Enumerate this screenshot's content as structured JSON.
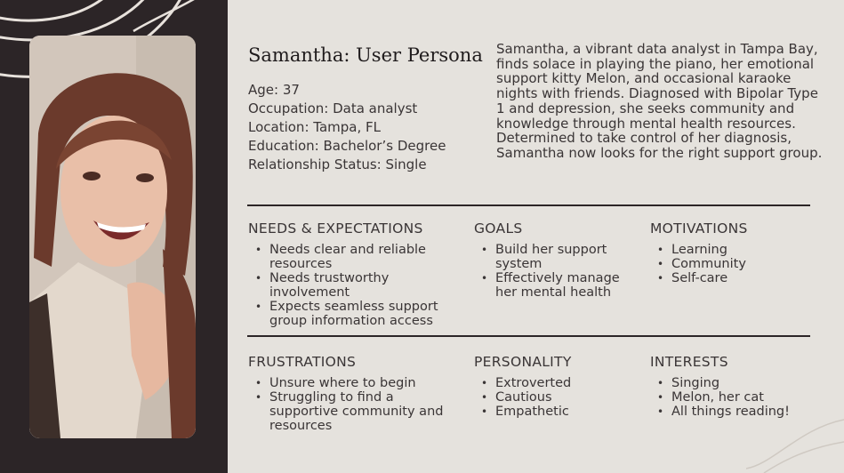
{
  "persona": {
    "title": "Samantha: User Persona",
    "facts": {
      "age": "Age: 37",
      "occupation": "Occupation: Data analyst",
      "location": "Location: Tampa, FL",
      "education": "Education: Bachelor’s Degree",
      "relationship": "Relationship Status: Single"
    },
    "bio": "Samantha, a vibrant data analyst in Tampa Bay, finds solace in playing the piano, her emotional support kitty Melon, and occasional karaoke nights with friends. Diagnosed with Bipolar Type 1 and depression, she seeks community and knowledge through mental health resources. Determined to take control of her diagnosis, Samantha now looks for the right support group."
  },
  "sections": {
    "needs": {
      "heading": "NEEDS & EXPECTATIONS",
      "items": [
        "Needs clear and reliable resources",
        "Needs trustworthy involvement",
        "Expects seamless support group information access"
      ]
    },
    "goals": {
      "heading": "GOALS",
      "items": [
        "Build her support system",
        "Effectively manage her mental health"
      ]
    },
    "motivations": {
      "heading": "MOTIVATIONS",
      "items": [
        "Learning",
        "Community",
        "Self-care"
      ]
    },
    "frustrations": {
      "heading": "FRUSTRATIONS",
      "items": [
        "Unsure where to begin",
        "Struggling to find a supportive community and resources"
      ]
    },
    "personality": {
      "heading": "PERSONALITY",
      "items": [
        "Extroverted",
        "Cautious",
        "Empathetic"
      ]
    },
    "interests": {
      "heading": "INTERESTS",
      "items": [
        "Singing",
        "Melon, her cat",
        "All things reading!"
      ]
    }
  },
  "colors": {
    "background": "#e5e2dd",
    "panel": "#2c2527",
    "text": "#3a3536"
  }
}
